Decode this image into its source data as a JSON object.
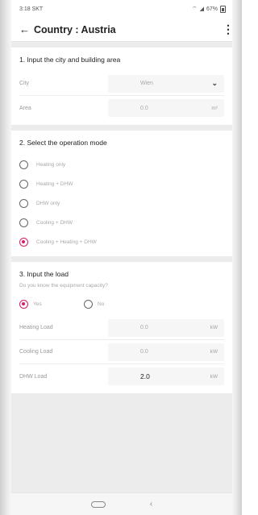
{
  "status": {
    "time": "3:18 SKT",
    "battery": "67%"
  },
  "appbar": {
    "title": "Country : Austria"
  },
  "section1": {
    "title": "1. Input the city and building area",
    "city_label": "City",
    "city_value": "Wien",
    "area_label": "Area",
    "area_value": "0.0",
    "area_unit": "m²"
  },
  "section2": {
    "title": "2. Select the operation mode",
    "options": [
      {
        "label": "Heating only",
        "selected": false
      },
      {
        "label": "Heating + DHW",
        "selected": false
      },
      {
        "label": "DHW only",
        "selected": false
      },
      {
        "label": "Cooling + DHW",
        "selected": false
      },
      {
        "label": "Cooling + Heating + DHW",
        "selected": true
      }
    ]
  },
  "section3": {
    "title": "3. Input the load",
    "question": "Do you know the equipment capacity?",
    "yes_label": "Yes",
    "no_label": "No",
    "yes_selected": true,
    "heating_label": "Heating Load",
    "heating_value": "0.0",
    "heating_unit": "kW",
    "cooling_label": "Cooling Load",
    "cooling_value": "0.0",
    "cooling_unit": "kW",
    "dhw_label": "DHW Load",
    "dhw_value": "2.0",
    "dhw_unit": "kW"
  },
  "colors": {
    "accent": "#d81b6a",
    "background": "#ececec"
  },
  "icons": {
    "back": "arrow-left-icon",
    "more": "more-icon",
    "dropdown": "chevron-down-icon"
  }
}
